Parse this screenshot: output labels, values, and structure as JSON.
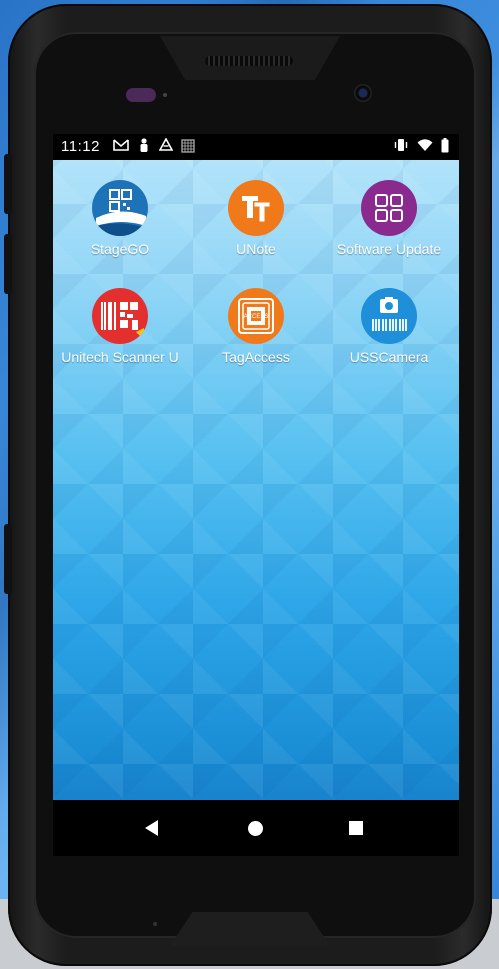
{
  "status_bar": {
    "time": "11:12",
    "left_icons": [
      "gmail-icon",
      "person-icon",
      "drive-icon",
      "calendar-icon"
    ],
    "right_icons": [
      "vibrate-icon",
      "wifi-icon",
      "battery-icon"
    ]
  },
  "apps": [
    {
      "label": "StageGO",
      "icon": "stagego-icon",
      "color": "#1e72b8"
    },
    {
      "label": "UNote",
      "icon": "unote-icon",
      "color": "#f07a1a"
    },
    {
      "label": "Software Update",
      "icon": "software-update-icon",
      "color": "#8a2a8e"
    },
    {
      "label": "Unitech Scanner U",
      "icon": "scanner-utility-icon",
      "color": "#e3302f"
    },
    {
      "label": "TagAccess",
      "icon": "tagaccess-icon",
      "color": "#f07a1a"
    },
    {
      "label": "USSCamera",
      "icon": "usscamera-icon",
      "color": "#1e8fd8"
    }
  ],
  "nav_bar": {
    "buttons": [
      "back-button",
      "home-button",
      "recents-button"
    ]
  },
  "colors": {
    "wallpaper_top": "#b9e6fb",
    "wallpaper_bottom": "#1676c2",
    "status_bar": "#000000"
  }
}
